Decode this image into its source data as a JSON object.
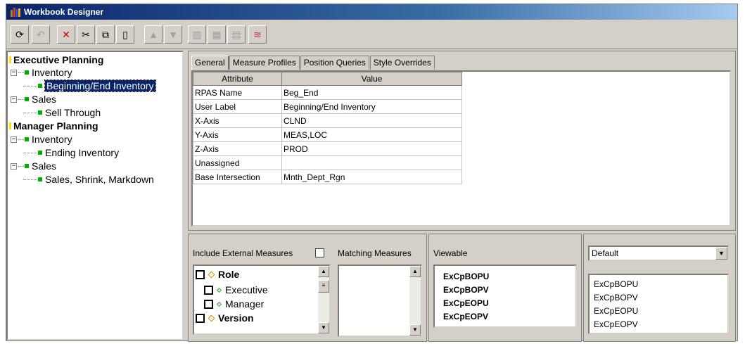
{
  "window": {
    "title": "Workbook Designer"
  },
  "toolbar": {
    "buttons": [
      "refresh-icon",
      "undo-icon",
      "delete-icon",
      "cut-icon",
      "copy-icon",
      "paste-icon",
      "move-up-icon",
      "move-down-icon",
      "library-icon",
      "grid-icon",
      "table-icon",
      "chart-icon"
    ]
  },
  "tree": {
    "groups": [
      {
        "label": "Executive Planning"
      },
      {
        "label": "Manager Planning"
      }
    ],
    "nodes": {
      "exec_inventory": "Inventory",
      "exec_beg_end": "Beginning/End Inventory",
      "exec_sales": "Sales",
      "exec_sell_through": "Sell Through",
      "mgr_inventory": "Inventory",
      "mgr_ending": "Ending Inventory",
      "mgr_sales": "Sales",
      "mgr_sales_shrink": "Sales, Shrink, Markdown"
    }
  },
  "tabs": [
    "General",
    "Measure Profiles",
    "Position Queries",
    "Style Overrides"
  ],
  "attr_table": {
    "headers": [
      "Attribute",
      "Value"
    ],
    "rows": [
      [
        "RPAS Name",
        "Beg_End"
      ],
      [
        "User Label",
        "Beginning/End Inventory"
      ],
      [
        "X-Axis",
        "CLND"
      ],
      [
        "Y-Axis",
        "MEAS,LOC"
      ],
      [
        "Z-Axis",
        "PROD"
      ],
      [
        "Unassigned",
        ""
      ],
      [
        "Base Intersection",
        "Mnth_Dept_Rgn"
      ]
    ]
  },
  "measures_panel": {
    "include_external_label": "Include External Measures",
    "matching_label": "Matching Measures",
    "role_items": [
      "Role",
      "Executive",
      "Manager",
      "Version"
    ]
  },
  "viewable": {
    "label": "Viewable",
    "items": [
      "ExCpBOPU",
      "ExCpBOPV",
      "ExCpEOPU",
      "ExCpEOPV"
    ]
  },
  "default_panel": {
    "select_value": "Default",
    "items": [
      "ExCpBOPU",
      "ExCpBOPV",
      "ExCpEOPU",
      "ExCpEOPV"
    ]
  }
}
